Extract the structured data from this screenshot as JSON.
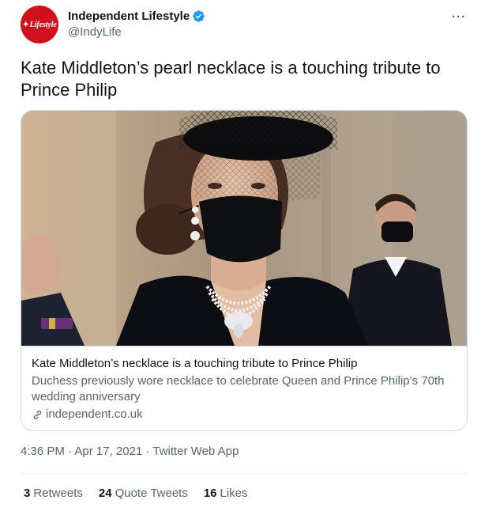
{
  "account": {
    "display_name": "Independent Lifestyle",
    "handle": "@IndyLife",
    "verified": true,
    "avatar_text": "Lifestyle",
    "avatar_color": "#d2101b",
    "more_label": "···"
  },
  "tweet": {
    "text": "Kate Middleton’s pearl necklace is a touching tribute to Prince Philip"
  },
  "card": {
    "title": "Kate Middleton’s necklace is a touching tribute to Prince Philip",
    "description": "Duchess previously wore necklace to celebrate Queen and Prince Philip’s 70th wedding anniversary",
    "domain": "independent.co.uk",
    "image_description": "photo"
  },
  "meta": {
    "time": "4:36 PM",
    "separator": " · ",
    "date": "Apr 17, 2021",
    "source": "Twitter Web App"
  },
  "stats": {
    "retweets_count": "3",
    "retweets_label": "Retweets",
    "quote_count": "24",
    "quote_label": "Quote Tweets",
    "likes_count": "16",
    "likes_label": "Likes"
  },
  "colors": {
    "accent": "#1d9bf0",
    "secondary_text": "#536471",
    "primary_text": "#0f1419",
    "border": "#cfd9de"
  }
}
